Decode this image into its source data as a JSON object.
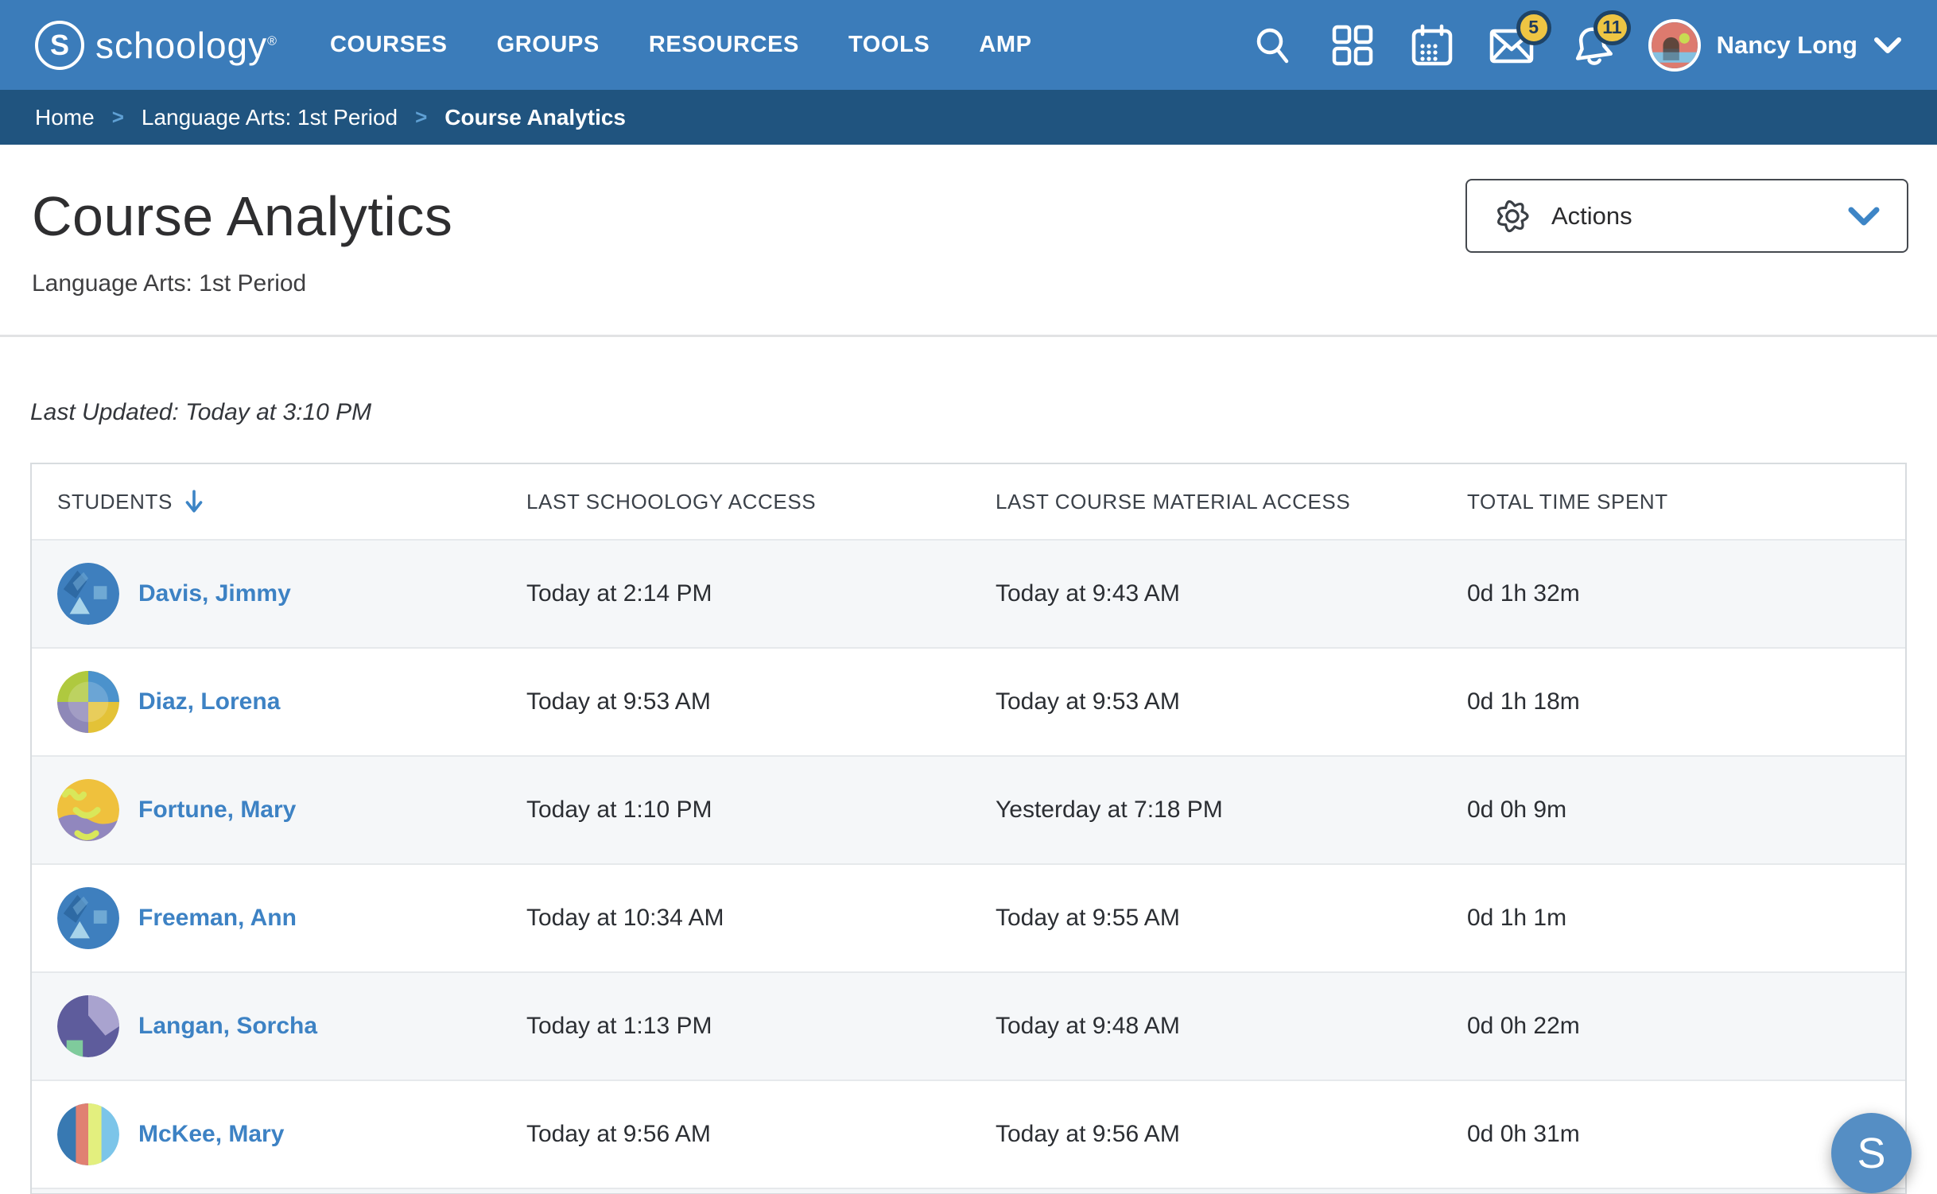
{
  "nav": {
    "brand_mark": "S",
    "brand": "schoology",
    "reg": "®",
    "items": [
      "COURSES",
      "GROUPS",
      "RESOURCES",
      "TOOLS",
      "AMP"
    ],
    "badges": {
      "messages": "5",
      "notifications": "11"
    },
    "user_name": "Nancy Long"
  },
  "breadcrumb": [
    "Home",
    "Language Arts: 1st Period",
    "Course Analytics"
  ],
  "page": {
    "title": "Course Analytics",
    "subtitle": "Language Arts: 1st Period",
    "actions_label": "Actions",
    "last_updated": "Last Updated: Today at 3:10 PM"
  },
  "table": {
    "headers": [
      "STUDENTS",
      "LAST SCHOOLOGY ACCESS",
      "LAST COURSE MATERIAL ACCESS",
      "TOTAL TIME SPENT"
    ],
    "sorted_column": "STUDENTS",
    "sort_direction": "descending",
    "rows": [
      {
        "name": "Davis, Jimmy",
        "avatar": "mountains",
        "last_schoology_access": "Today at 2:14 PM",
        "last_course_material_access": "Today at 9:43 AM",
        "total_time_spent": "0d 1h 32m"
      },
      {
        "name": "Diaz, Lorena",
        "avatar": "quadrants",
        "last_schoology_access": "Today at 9:53 AM",
        "last_course_material_access": "Today at 9:53 AM",
        "total_time_spent": "0d 1h 18m"
      },
      {
        "name": "Fortune, Mary",
        "avatar": "face",
        "last_schoology_access": "Today at 1:10 PM",
        "last_course_material_access": "Yesterday at 7:18 PM",
        "total_time_spent": "0d 0h 9m"
      },
      {
        "name": "Freeman, Ann",
        "avatar": "mountains",
        "last_schoology_access": "Today at 10:34 AM",
        "last_course_material_access": "Today at 9:55 AM",
        "total_time_spent": "0d 1h 1m"
      },
      {
        "name": "Langan, Sorcha",
        "avatar": "pie",
        "last_schoology_access": "Today at 1:13 PM",
        "last_course_material_access": "Today at 9:48 AM",
        "total_time_spent": "0d 0h 22m"
      },
      {
        "name": "McKee, Mary",
        "avatar": "stripes",
        "last_schoology_access": "Today at 9:56 AM",
        "last_course_material_access": "Today at 9:56 AM",
        "total_time_spent": "0d 0h 31m"
      }
    ]
  },
  "floating_button": {
    "label": "S"
  },
  "colors": {
    "nav_blue": "#3B7CBA",
    "breadcrumb_blue": "#20547F",
    "link_blue": "#3D82C4",
    "badge_yellow": "#EEC543",
    "badge_ring": "#1E4366",
    "row_alt": "#F5F7F9",
    "floating_blue": "#558EC4"
  }
}
